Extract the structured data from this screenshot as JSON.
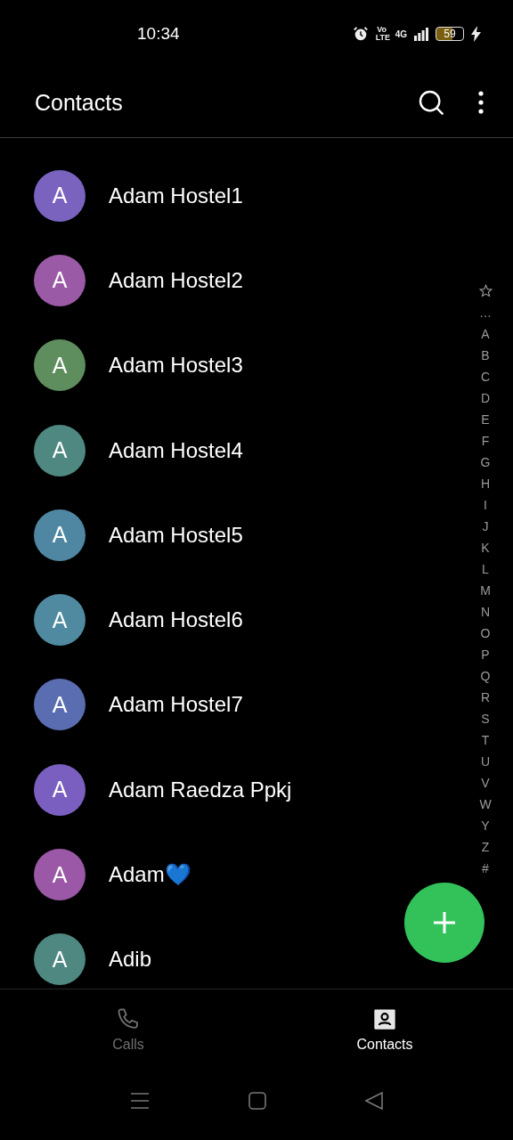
{
  "status_bar": {
    "time": "10:34",
    "volte": "Vo LTE",
    "network": "4G",
    "battery": "59"
  },
  "header": {
    "title": "Contacts"
  },
  "contacts": [
    {
      "initial": "A",
      "name": "Adam Hostel1",
      "color": "#7a63bf"
    },
    {
      "initial": "A",
      "name": "Adam Hostel2",
      "color": "#9a5aa5"
    },
    {
      "initial": "A",
      "name": "Adam Hostel3",
      "color": "#5e8e5d"
    },
    {
      "initial": "A",
      "name": "Adam Hostel4",
      "color": "#4e8880"
    },
    {
      "initial": "A",
      "name": "Adam Hostel5",
      "color": "#4f87a2"
    },
    {
      "initial": "A",
      "name": "Adam Hostel6",
      "color": "#4f8aa0"
    },
    {
      "initial": "A",
      "name": "Adam Hostel7",
      "color": "#5a6db0"
    },
    {
      "initial": "A",
      "name": "Adam Raedza Ppkj",
      "color": "#7a5fc0"
    },
    {
      "initial": "A",
      "name": "Adam💙",
      "color": "#9a58a6"
    },
    {
      "initial": "A",
      "name": "Adib",
      "color": "#4e8880"
    }
  ],
  "index": [
    "…",
    "A",
    "B",
    "C",
    "D",
    "E",
    "F",
    "G",
    "H",
    "I",
    "J",
    "K",
    "L",
    "M",
    "N",
    "O",
    "P",
    "Q",
    "R",
    "S",
    "T",
    "U",
    "V",
    "W",
    "Y",
    "Z",
    "#"
  ],
  "bottom_nav": [
    {
      "label": "Calls",
      "kind": "calls",
      "selected": false
    },
    {
      "label": "Contacts",
      "kind": "contacts",
      "selected": true
    }
  ]
}
